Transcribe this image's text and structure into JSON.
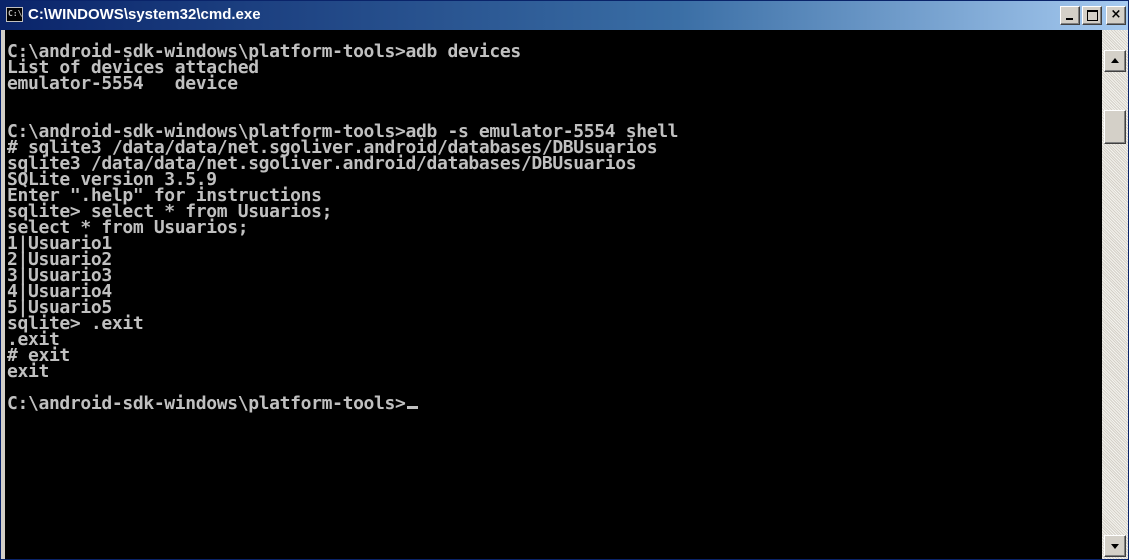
{
  "window": {
    "title": "C:\\WINDOWS\\system32\\cmd.exe",
    "icon": "cmd-icon",
    "icon_text": "C:\\"
  },
  "caption_buttons": {
    "minimize": "minimize-icon",
    "maximize": "maximize-icon",
    "close": "close-icon",
    "close_glyph": "×"
  },
  "console": {
    "colors": {
      "background": "#000000",
      "text": "#c0c0c0"
    },
    "lines": [
      "C:\\android-sdk-windows\\platform-tools>adb devices",
      "List of devices attached",
      "emulator-5554   device",
      "",
      "",
      "C:\\android-sdk-windows\\platform-tools>adb -s emulator-5554 shell",
      "# sqlite3 /data/data/net.sgoliver.android/databases/DBUsuarios",
      "sqlite3 /data/data/net.sgoliver.android/databases/DBUsuarios",
      "SQLite version 3.5.9",
      "Enter \".help\" for instructions",
      "sqlite> select * from Usuarios;",
      "select * from Usuarios;",
      "1|Usuario1",
      "2|Usuario2",
      "3|Usuario3",
      "4|Usuario4",
      "5|Usuario5",
      "sqlite> .exit",
      ".exit",
      "# exit",
      "exit",
      "",
      "C:\\android-sdk-windows\\platform-tools>"
    ]
  },
  "scrollbar": {
    "up": "scroll-up-arrow-icon",
    "down": "scroll-down-arrow-icon"
  }
}
